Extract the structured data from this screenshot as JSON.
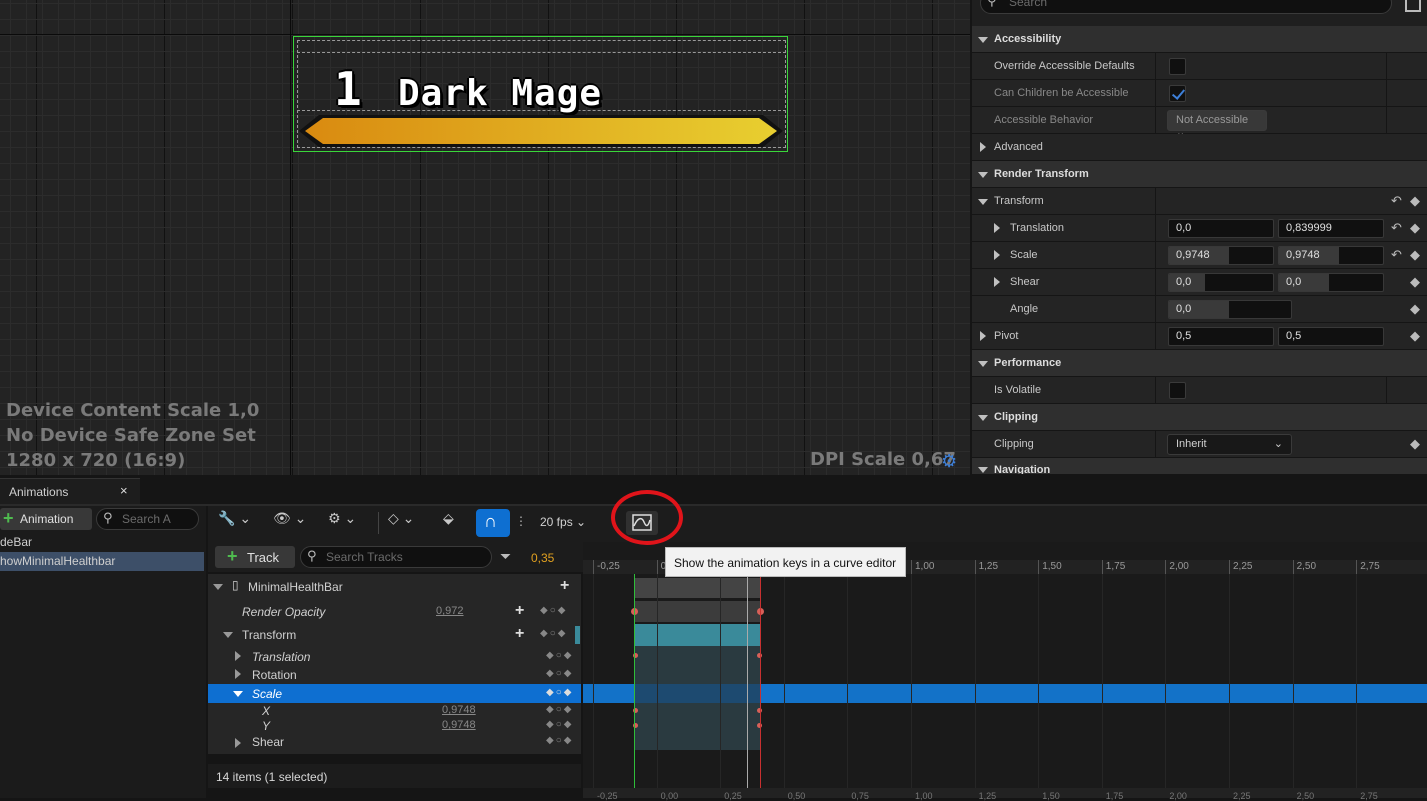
{
  "viewport": {
    "widget": {
      "level": "1",
      "name": "Dark Mage"
    },
    "info": {
      "content_scale": "Device Content Scale 1,0",
      "safe_zone": "No Device Safe Zone Set",
      "resolution": "1280 x 720 (16:9)",
      "dpi_scale": "DPI Scale 0,67"
    }
  },
  "details": {
    "search_placeholder": "Search",
    "sections": {
      "accessibility": "Accessibility",
      "override_defaults": "Override Accessible Defaults",
      "can_children": "Can Children be Accessible",
      "accessible_behavior": "Accessible Behavior",
      "accessible_behavior_value": "Not Accessible",
      "advanced": "Advanced",
      "render_transform": "Render Transform",
      "transform": "Transform",
      "translation": "Translation",
      "translation_x": "0,0",
      "translation_y": "0,839999",
      "scale": "Scale",
      "scale_x": "0,9748",
      "scale_y": "0,9748",
      "shear": "Shear",
      "shear_x": "0,0",
      "shear_y": "0,0",
      "angle": "Angle",
      "angle_value": "0,0",
      "pivot": "Pivot",
      "pivot_x": "0,5",
      "pivot_y": "0,5",
      "performance": "Performance",
      "is_volatile": "Is Volatile",
      "clipping_section": "Clipping",
      "clipping": "Clipping",
      "clipping_value": "Inherit",
      "navigation": "Navigation"
    },
    "checks": {
      "override_defaults": false,
      "can_children": true,
      "is_volatile": false
    }
  },
  "animations": {
    "tab_title": "Animations",
    "close": "×",
    "add_label": "Animation",
    "search_placeholder": "Search A",
    "items": [
      "deBar",
      "howMinimalHealthbar"
    ],
    "selected_index": 1
  },
  "sequencer": {
    "fps": "20 fps",
    "add_track_label": "Track",
    "search_tracks_placeholder": "Search Tracks",
    "current_time": "0,35",
    "tooltip": "Show the animation keys in a curve editor",
    "tracks": {
      "root": "MinimalHealthBar",
      "render_opacity": "Render Opacity",
      "render_opacity_value": "0,972",
      "transform": "Transform",
      "translation": "Translation",
      "rotation": "Rotation",
      "scale": "Scale",
      "x": "X",
      "x_value": "0,9748",
      "y": "Y",
      "y_value": "0,9748",
      "shear": "Shear"
    },
    "status": "14 items (1 selected)",
    "ruler": [
      "-0,25",
      "0,00",
      "0,25",
      "0,50",
      "0,75",
      "1,00",
      "1,25",
      "1,50",
      "1,75",
      "2,00",
      "2,25",
      "2,50",
      "2,75"
    ],
    "bottom_ruler": [
      "-0,25",
      "0,00",
      "0,25",
      "0,50",
      "0,75",
      "1,00",
      "1,25",
      "1,50",
      "1,75",
      "2,00",
      "2,25",
      "2,50",
      "2,75"
    ]
  },
  "colors": {
    "accent_blue": "#0e6fd1",
    "selection_green": "#3ad63a",
    "annotation_red": "#e0141a",
    "time_orange": "#e0a020"
  }
}
